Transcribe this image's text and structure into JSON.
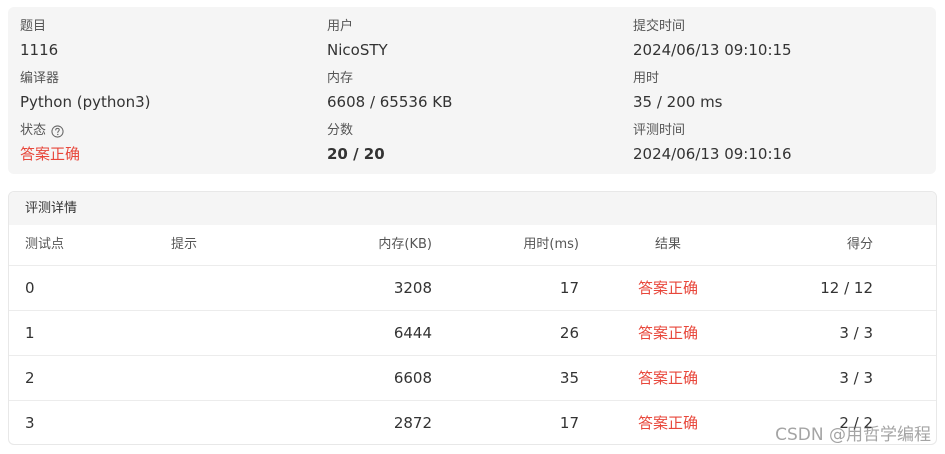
{
  "summary": {
    "problem": {
      "label": "题目",
      "value": "1116"
    },
    "user": {
      "label": "用户",
      "value": "NicoSTY"
    },
    "submit_time": {
      "label": "提交时间",
      "value": "2024/06/13 09:10:15"
    },
    "compiler": {
      "label": "编译器",
      "value": "Python (python3)"
    },
    "memory": {
      "label": "内存",
      "value": "6608 / 65536 KB"
    },
    "time_used": {
      "label": "用时",
      "value": "35 / 200 ms"
    },
    "status": {
      "label": "状态",
      "value": "答案正确",
      "icon": "question-circle-icon"
    },
    "score": {
      "label": "分数",
      "value": "20 / 20"
    },
    "judge_time": {
      "label": "评测时间",
      "value": "2024/06/13 09:10:16"
    }
  },
  "details": {
    "title": "评测详情",
    "columns": {
      "point": "测试点",
      "hint": "提示",
      "memory": "内存(KB)",
      "time": "用时(ms)",
      "result": "结果",
      "score": "得分"
    },
    "rows": [
      {
        "point": "0",
        "hint": "",
        "memory": "3208",
        "time": "17",
        "result": "答案正确",
        "score": "12 / 12"
      },
      {
        "point": "1",
        "hint": "",
        "memory": "6444",
        "time": "26",
        "result": "答案正确",
        "score": "3 / 3"
      },
      {
        "point": "2",
        "hint": "",
        "memory": "6608",
        "time": "35",
        "result": "答案正确",
        "score": "3 / 3"
      },
      {
        "point": "3",
        "hint": "",
        "memory": "2872",
        "time": "17",
        "result": "答案正确",
        "score": "2 / 2"
      }
    ]
  },
  "watermark": "CSDN @用哲学编程",
  "colors": {
    "accent": "#e8473b",
    "panel_bg": "#f5f5f5",
    "border": "#e8e8e8"
  }
}
